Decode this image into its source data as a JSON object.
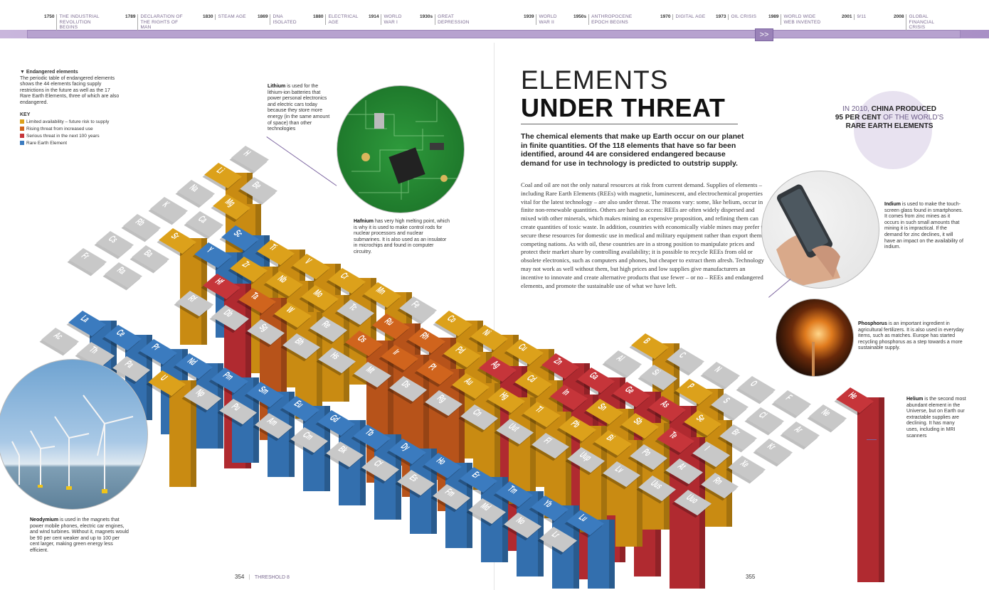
{
  "timeline": {
    "events": [
      {
        "year": "1750",
        "label": "The Industrial Revolution begins"
      },
      {
        "year": "1789",
        "label": "Declaration of the Rights of Man"
      },
      {
        "year": "1830",
        "label": "Steam age"
      },
      {
        "year": "1869",
        "label": "DNA isolated"
      },
      {
        "year": "1880",
        "label": "Electrical age"
      },
      {
        "year": "1914",
        "label": "World War I"
      },
      {
        "year": "1930s",
        "label": "Great Depression"
      },
      {
        "year": "1939",
        "label": "World War II"
      },
      {
        "year": "1950s",
        "label": "Anthropocene epoch begins"
      },
      {
        "year": "1970",
        "label": "Digital age"
      },
      {
        "year": "1973",
        "label": "Oil crisis"
      },
      {
        "year": "1989",
        "label": "World Wide Web invented"
      },
      {
        "year": "2001",
        "label": "9/11"
      },
      {
        "year": "2008",
        "label": "Global financial crisis"
      }
    ],
    "arrow": ">>"
  },
  "sidebar": {
    "heading": "▼ Endangered elements",
    "text": "The periodic table of endangered elements shows the 44 elements facing supply restrictions in the future as well as the 17 Rare Earth Elements, three of which are also endangered.",
    "key_title": "KEY",
    "key": [
      {
        "label": "Limited availability – future risk to supply",
        "color": "#dca11b"
      },
      {
        "label": "Rising threat from increased use",
        "color": "#d0641d"
      },
      {
        "label": "Serious threat in the next 100 years",
        "color": "#c6353a"
      },
      {
        "label": "Rare Earth Element",
        "color": "#3b7bbf"
      }
    ]
  },
  "title": {
    "line1": "ELEMENTS",
    "line2": "UNDER THREAT"
  },
  "lede": "The chemical elements that make up Earth occur on our planet in finite quantities. Of the 118 elements that have so far been identified, around 44 are considered endangered because demand for use in technology is predicted to outstrip supply.",
  "body": "Coal and oil are not the only natural resources at risk from current demand. Supplies of elements – including Rare Earth Elements (REEs) with magnetic, luminescent, and electrochemical properties vital for the latest technology – are also under threat. The reasons vary: some, like helium, occur in finite non-renewable quantities. Others are hard to access: REEs are often widely dispersed and mixed with other minerals, which makes mining an expensive proposition, and refining them can create quantities of toxic waste. In addition, countries with economically viable mines may prefer to secure these resources for domestic use in medical and military equipment rather than export them to competing nations. As with oil, these countries are in a strong position to manipulate prices and protect their market share by controlling availability; it is possible to recycle REEs from old or obsolete electronics, such as computers and phones, but cheaper to extract them afresh. Technology may not work as well without them, but high prices and low supplies give manufacturers an incentive to innovate and create alternative products that use fewer – or no – REEs and endangered elements, and promote the sustainable use of what we have left.",
  "fact": {
    "pre": "IN 2010, ",
    "bold1": "CHINA PRODUCED",
    "bold2": "95 PER CENT",
    "mid": " OF THE WORLD'S",
    "bold3": "RARE EARTH ELEMENTS"
  },
  "captions": {
    "lithium": {
      "name": "Lithium",
      "text": " is used for the lithium-ion batteries that power personal electronics and electric cars today because they store more energy (in the same amount of space) than other technologies"
    },
    "hafnium": {
      "name": "Hafnium",
      "text": " has very high melting point, which is why it is used to make control rods for nuclear processors and nuclear submarines. It is also used as an insulator in microchips and found in computer circuitry."
    },
    "indium": {
      "name": "Indium",
      "text": " is used to make the touch-screen glass found in smartphones. It comes from zinc mines as it occurs in such small amounts that mining it is impractical. If the demand for zinc declines, it will have an impact on the availability of indium."
    },
    "phosphorus": {
      "name": "Phosphorus",
      "text": " is an important ingredient in agricultural fertilizers. It is also used in everyday items, such as matches. Europe has started recycling phosphorus as a step towards a more sustainable supply."
    },
    "helium": {
      "name": "Helium",
      "text": " is the second most abundant element in the Universe, but on Earth our extractable supplies are declining. It has many uses, including in MRI scanners"
    },
    "neodymium": {
      "name": "Neodymium",
      "text": " is used in the magnets that power mobile phones, electric car engines, and wind turbines. Without it, magnets would be 90 per cent weaker and up to 100 per cent larger, making green energy less efficient."
    }
  },
  "folio": {
    "left_num": "354",
    "left_label": "THRESHOLD 8",
    "right_num": "355"
  },
  "elements": [
    {
      "s": "H",
      "c": "grey"
    },
    {
      "s": "Li",
      "c": "yellow"
    },
    {
      "s": "Be",
      "c": "grey"
    },
    {
      "s": "Na",
      "c": "grey"
    },
    {
      "s": "Mg",
      "c": "yellow"
    },
    {
      "s": "K",
      "c": "grey"
    },
    {
      "s": "Ca",
      "c": "grey"
    },
    {
      "s": "Sc",
      "c": "blue"
    },
    {
      "s": "Rb",
      "c": "grey"
    },
    {
      "s": "Sr",
      "c": "yellow"
    },
    {
      "s": "Y",
      "c": "blue"
    },
    {
      "s": "Cs",
      "c": "grey"
    },
    {
      "s": "Ba",
      "c": "grey"
    },
    {
      "s": "Fr",
      "c": "grey"
    },
    {
      "s": "Ra",
      "c": "grey"
    },
    {
      "s": "Ti",
      "c": "yellow"
    },
    {
      "s": "V",
      "c": "yellow"
    },
    {
      "s": "Cr",
      "c": "yellow"
    },
    {
      "s": "Mn",
      "c": "yellow"
    },
    {
      "s": "Zr",
      "c": "yellow"
    },
    {
      "s": "Nb",
      "c": "yellow"
    },
    {
      "s": "Mo",
      "c": "yellow"
    },
    {
      "s": "Hf",
      "c": "red"
    },
    {
      "s": "Ta",
      "c": "orange"
    },
    {
      "s": "W",
      "c": "yellow"
    },
    {
      "s": "Rf",
      "c": "grey"
    },
    {
      "s": "Db",
      "c": "grey"
    },
    {
      "s": "Sg",
      "c": "grey"
    },
    {
      "s": "Bh",
      "c": "grey"
    },
    {
      "s": "Tc",
      "c": "grey"
    },
    {
      "s": "Re",
      "c": "grey"
    },
    {
      "s": "Hs",
      "c": "grey"
    },
    {
      "s": "Fe",
      "c": "grey"
    },
    {
      "s": "Ru",
      "c": "orange"
    },
    {
      "s": "Os",
      "c": "orange"
    },
    {
      "s": "Mt",
      "c": "grey"
    },
    {
      "s": "Co",
      "c": "yellow"
    },
    {
      "s": "Rh",
      "c": "orange"
    },
    {
      "s": "Ir",
      "c": "orange"
    },
    {
      "s": "Ds",
      "c": "grey"
    },
    {
      "s": "Ni",
      "c": "yellow"
    },
    {
      "s": "Pd",
      "c": "yellow"
    },
    {
      "s": "Pt",
      "c": "orange"
    },
    {
      "s": "Rg",
      "c": "grey"
    },
    {
      "s": "Cu",
      "c": "yellow"
    },
    {
      "s": "Ag",
      "c": "red"
    },
    {
      "s": "Au",
      "c": "yellow"
    },
    {
      "s": "Cn",
      "c": "grey"
    },
    {
      "s": "Zn",
      "c": "red"
    },
    {
      "s": "Cd",
      "c": "yellow"
    },
    {
      "s": "Hg",
      "c": "yellow"
    },
    {
      "s": "Uut",
      "c": "grey"
    },
    {
      "s": "B",
      "c": "yellow"
    },
    {
      "s": "Al",
      "c": "grey"
    },
    {
      "s": "Ga",
      "c": "red"
    },
    {
      "s": "In",
      "c": "red"
    },
    {
      "s": "Tl",
      "c": "yellow"
    },
    {
      "s": "C",
      "c": "grey"
    },
    {
      "s": "Si",
      "c": "grey"
    },
    {
      "s": "Ge",
      "c": "red"
    },
    {
      "s": "Sn",
      "c": "yellow"
    },
    {
      "s": "Pb",
      "c": "yellow"
    },
    {
      "s": "Fl",
      "c": "grey"
    },
    {
      "s": "N",
      "c": "grey"
    },
    {
      "s": "P",
      "c": "yellow"
    },
    {
      "s": "As",
      "c": "red"
    },
    {
      "s": "Sb",
      "c": "yellow"
    },
    {
      "s": "Bi",
      "c": "yellow"
    },
    {
      "s": "Uup",
      "c": "grey"
    },
    {
      "s": "O",
      "c": "grey"
    },
    {
      "s": "S",
      "c": "grey"
    },
    {
      "s": "Se",
      "c": "yellow"
    },
    {
      "s": "Te",
      "c": "red"
    },
    {
      "s": "Po",
      "c": "grey"
    },
    {
      "s": "Lv",
      "c": "grey"
    },
    {
      "s": "F",
      "c": "grey"
    },
    {
      "s": "Cl",
      "c": "grey"
    },
    {
      "s": "Br",
      "c": "grey"
    },
    {
      "s": "I",
      "c": "grey"
    },
    {
      "s": "At",
      "c": "grey"
    },
    {
      "s": "Uus",
      "c": "grey"
    },
    {
      "s": "He",
      "c": "red"
    },
    {
      "s": "Ne",
      "c": "grey"
    },
    {
      "s": "Ar",
      "c": "grey"
    },
    {
      "s": "Kr",
      "c": "grey"
    },
    {
      "s": "Xe",
      "c": "grey"
    },
    {
      "s": "Rn",
      "c": "grey"
    },
    {
      "s": "Uuo",
      "c": "grey"
    },
    {
      "s": "La",
      "c": "blue"
    },
    {
      "s": "Ce",
      "c": "blue"
    },
    {
      "s": "Pr",
      "c": "blue"
    },
    {
      "s": "Nd",
      "c": "blue"
    },
    {
      "s": "Pm",
      "c": "blue"
    },
    {
      "s": "Sm",
      "c": "blue"
    },
    {
      "s": "Eu",
      "c": "blue"
    },
    {
      "s": "Gd",
      "c": "blue"
    },
    {
      "s": "Tb",
      "c": "blue"
    },
    {
      "s": "Dy",
      "c": "blue"
    },
    {
      "s": "Ho",
      "c": "blue"
    },
    {
      "s": "Er",
      "c": "blue"
    },
    {
      "s": "Tm",
      "c": "blue"
    },
    {
      "s": "Yb",
      "c": "blue"
    },
    {
      "s": "Lu",
      "c": "blue"
    },
    {
      "s": "Ac",
      "c": "grey"
    },
    {
      "s": "Th",
      "c": "grey"
    },
    {
      "s": "Pa",
      "c": "grey"
    },
    {
      "s": "U",
      "c": "yellow"
    },
    {
      "s": "Np",
      "c": "grey"
    },
    {
      "s": "Pu",
      "c": "grey"
    },
    {
      "s": "Am",
      "c": "grey"
    },
    {
      "s": "Cm",
      "c": "grey"
    },
    {
      "s": "Bk",
      "c": "grey"
    },
    {
      "s": "Cf",
      "c": "grey"
    },
    {
      "s": "Es",
      "c": "grey"
    },
    {
      "s": "Fm",
      "c": "grey"
    },
    {
      "s": "Md",
      "c": "grey"
    },
    {
      "s": "No",
      "c": "grey"
    },
    {
      "s": "Lr",
      "c": "grey"
    }
  ],
  "colors": {
    "grey": "#c8c8c8",
    "yellow": "#dca11b",
    "orange": "#d0641d",
    "red": "#c6353a",
    "blue": "#3b7bbf",
    "accent": "#7c65a0"
  }
}
